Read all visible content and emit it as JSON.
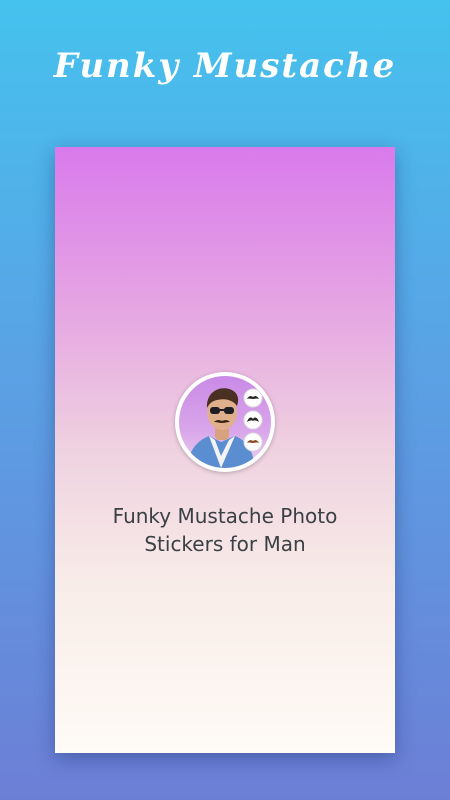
{
  "promo": {
    "title": "Funky Mustache"
  },
  "splash": {
    "app_title_line1": "Funky Mustache Photo",
    "app_title_line2": "Stickers for Man",
    "logo_icon": "app-logo-icon"
  },
  "colors": {
    "background_top": "#45c2ee",
    "background_bottom": "#6c7fd6",
    "card_top": "#d97aec",
    "card_bottom": "#fffbf6",
    "title_text": "#ffffff",
    "app_title_text": "#3b4045"
  }
}
